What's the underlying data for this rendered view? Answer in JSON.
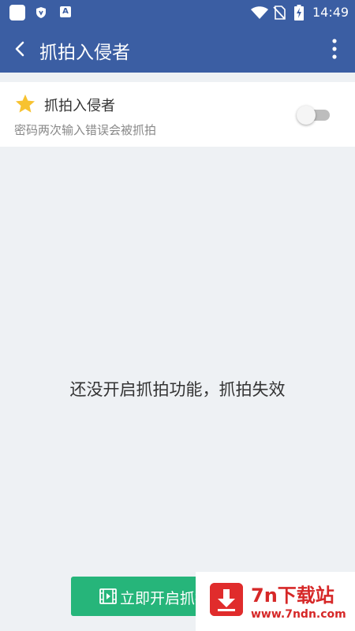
{
  "status_bar": {
    "time": "14:49",
    "notification_letter": "A",
    "icons": [
      "app-notification-icon",
      "shield-icon",
      "a-icon",
      "wifi-icon",
      "no-sim-icon",
      "battery-charging-icon"
    ]
  },
  "app_bar": {
    "title": "抓拍入侵者",
    "back_icon": "back-arrow-icon",
    "more_icon": "more-vert-icon"
  },
  "setting": {
    "label": "抓拍入侵者",
    "description": "密码两次输入错误会被抓拍",
    "enabled": false,
    "icon": "star-icon"
  },
  "empty_state": {
    "message": "还没开启抓拍功能，抓拍失效"
  },
  "action_button": {
    "label": "立即开启抓拍",
    "icon": "film-icon"
  },
  "watermark": {
    "title": "7n下载站",
    "url": "www.7ndn.com"
  },
  "colors": {
    "primary": "#3b5ea3",
    "button_green": "#26b57a",
    "background": "#eef1f4",
    "watermark_red": "#d62828"
  }
}
